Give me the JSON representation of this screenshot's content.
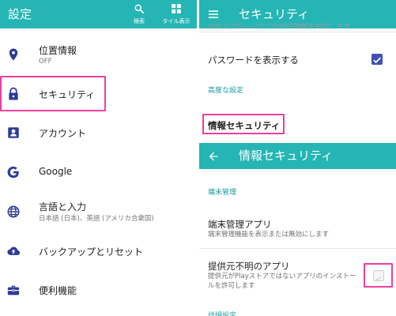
{
  "left": {
    "appbar": {
      "title": "設定",
      "search_label": "検索",
      "tile_label": "タイル表示"
    },
    "menu": [
      {
        "label": "位置情報",
        "sub": "OFF",
        "icon": "location-pin-icon"
      },
      {
        "label": "セキュリティ",
        "icon": "lock-icon"
      },
      {
        "label": "アカウント",
        "icon": "account-icon"
      },
      {
        "label": "Google",
        "icon": "google-g-icon"
      },
      {
        "label": "言語と入力",
        "sub": "日本語 (日本)、英語 (アメリカ合衆国)",
        "icon": "globe-icon"
      },
      {
        "label": "バックアップとリセット",
        "icon": "cloud-upload-icon"
      },
      {
        "label": "便利機能",
        "icon": "toolbox-icon"
      }
    ]
  },
  "right_top": {
    "title": "セキュリティ",
    "clipped_text": "IDやパスワードなどの認証情報を設定します",
    "show_password_label": "パスワードを表示する",
    "show_password_checked": true,
    "advanced_section": "高度な設定",
    "info_security_label": "情報セキュリティ"
  },
  "right_bottom": {
    "title": "情報セキュリティ",
    "device_admin_section": "端末管理",
    "device_admin_apps_label": "端末管理アプリ",
    "device_admin_apps_sub": "端末管理機能を表示または無効にします",
    "unknown_sources_label": "提供元不明のアプリ",
    "unknown_sources_sub": "提供元がPlayストアではないアプリのインストールを許可します",
    "unknown_sources_checked": false,
    "detail_section": "詳細設定"
  },
  "colors": {
    "appbar": "#26b5b5",
    "accent": "#1a9a9a",
    "icon": "#2d3b96",
    "highlight": "#ea3fa0",
    "checkbox_checked": "#3f51b5"
  }
}
